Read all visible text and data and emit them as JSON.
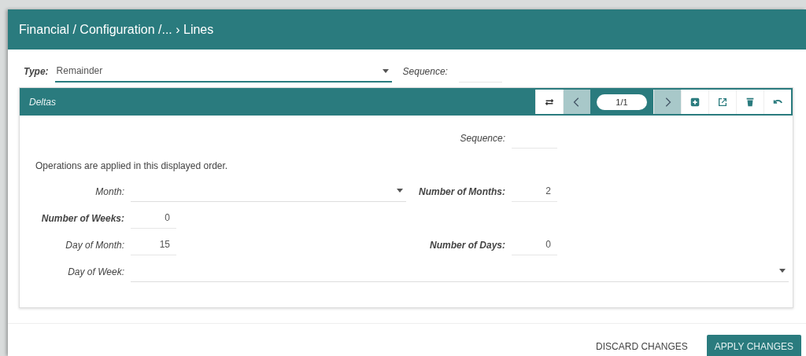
{
  "breadcrumb": "Financial / Configuration /... › Lines",
  "type_field": {
    "label": "Type:",
    "value": "Remainder",
    "required": true
  },
  "sequence_field": {
    "label": "Sequence:"
  },
  "panel": {
    "title": "Deltas",
    "pager": "1/1",
    "prev_disabled": true,
    "next_disabled": true,
    "rows": [
      {
        "right": {
          "label": "Sequence:",
          "kind": "number",
          "required": false
        }
      },
      {
        "note": "Operations are applied in this displayed order."
      },
      {
        "left": {
          "label": "Month:",
          "kind": "select",
          "required": false
        },
        "right": {
          "label": "Number of Months:",
          "kind": "number",
          "value": "2",
          "required": true
        }
      },
      {
        "left": {
          "label": "Number of Weeks:",
          "kind": "number",
          "value": "0",
          "required": true
        }
      },
      {
        "left": {
          "label": "Day of Month:",
          "kind": "number",
          "value": "15",
          "required": false
        },
        "right": {
          "label": "Number of Days:",
          "kind": "number",
          "value": "0",
          "required": true
        }
      },
      {
        "left": {
          "label": "Day of Week:",
          "kind": "wide_select",
          "required": false
        }
      }
    ]
  },
  "buttons": [
    {
      "label": "DISCARD CHANGES",
      "kind": "flat"
    },
    {
      "label": "APPLY CHANGES",
      "kind": "primary"
    }
  ]
}
